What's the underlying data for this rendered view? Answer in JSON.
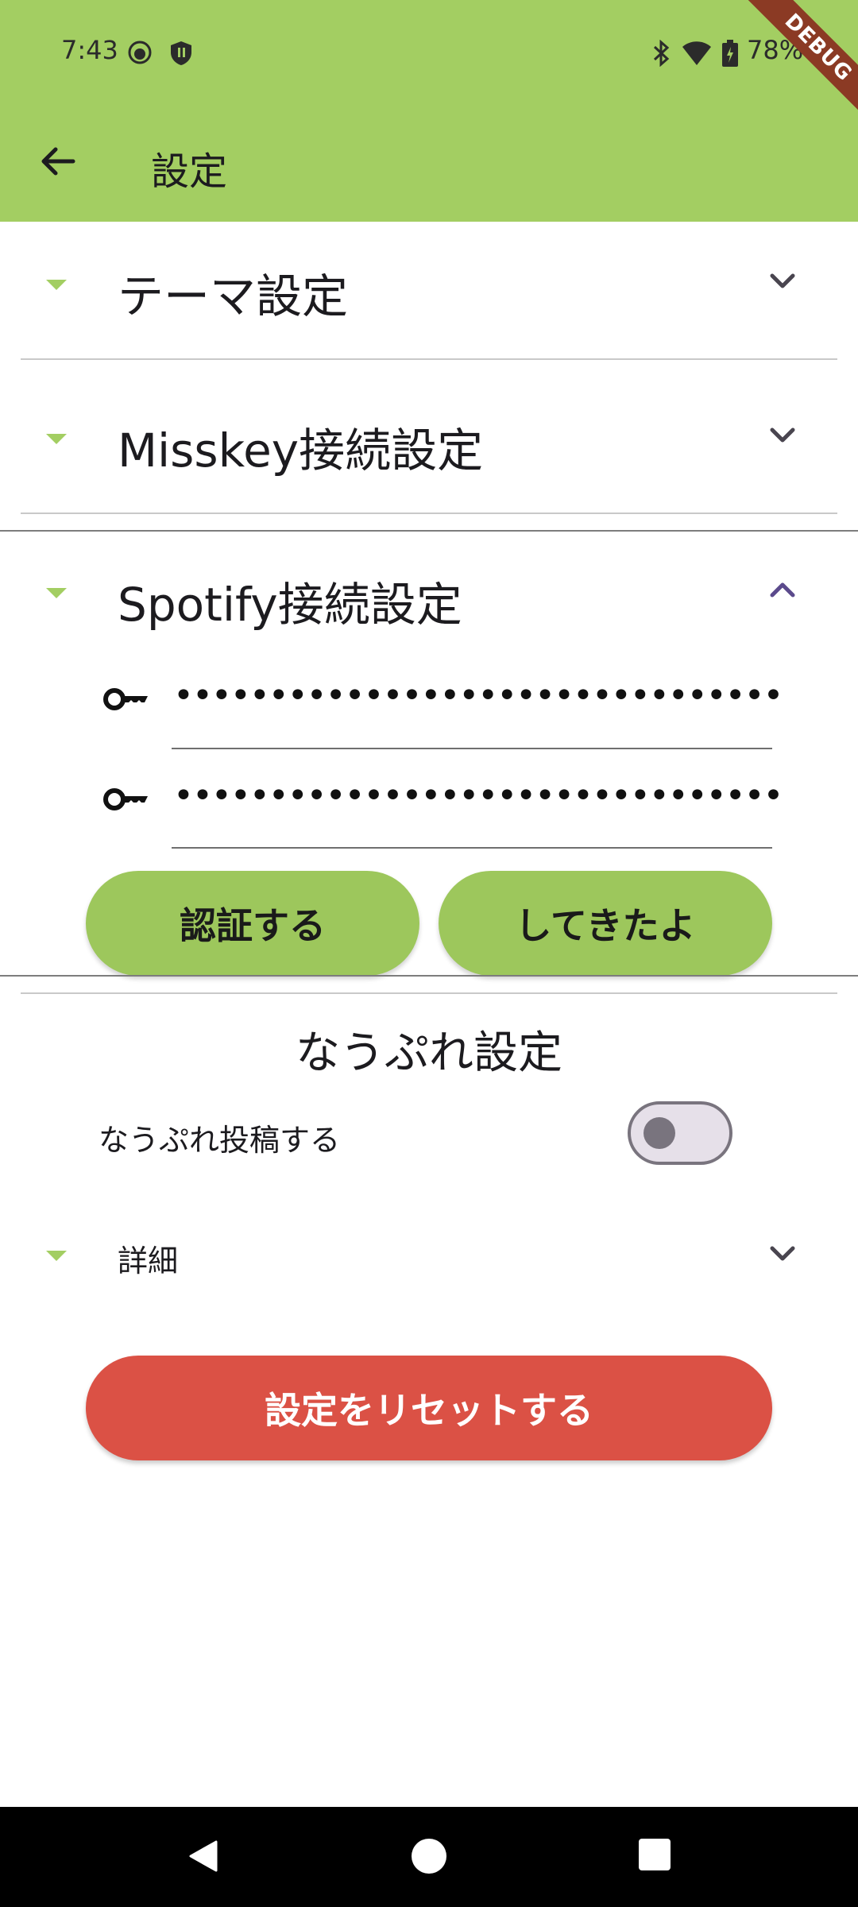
{
  "status_bar": {
    "time": "7:43",
    "battery": "78%",
    "icons": [
      "face-icon",
      "shield-icon",
      "bluetooth-icon",
      "wifi-icon",
      "battery-icon"
    ]
  },
  "debug_banner": "DEBUG",
  "app_bar": {
    "title": "設定",
    "back_icon": "arrow-back-icon",
    "color": "#a3ce62"
  },
  "sections": [
    {
      "title": "テーマ設定",
      "expanded": false
    },
    {
      "title": "Misskey接続設定",
      "expanded": false
    },
    {
      "title": "Spotify接続設定",
      "expanded": true,
      "fields": [
        {
          "icon": "key-icon",
          "value": "••••••••••••••••••••••••••••••••"
        },
        {
          "icon": "key-icon",
          "value": "••••••••••••••••••••••••••••••••"
        }
      ],
      "buttons": {
        "auth": "認証する",
        "done": "してきたよ"
      }
    }
  ],
  "nowplaying": {
    "title": "なうぷれ設定",
    "toggle_label": "なうぷれ投稿する",
    "toggle_on": false,
    "details_title": "詳細"
  },
  "reset_button": "設定をリセットする",
  "colors": {
    "accent": "#a3ce62",
    "button_green": "#9dc75c",
    "reset_red": "#db5145",
    "chevron_active": "#5b4a8c"
  },
  "nav_bar": [
    "back-icon",
    "home-icon",
    "recents-icon"
  ]
}
